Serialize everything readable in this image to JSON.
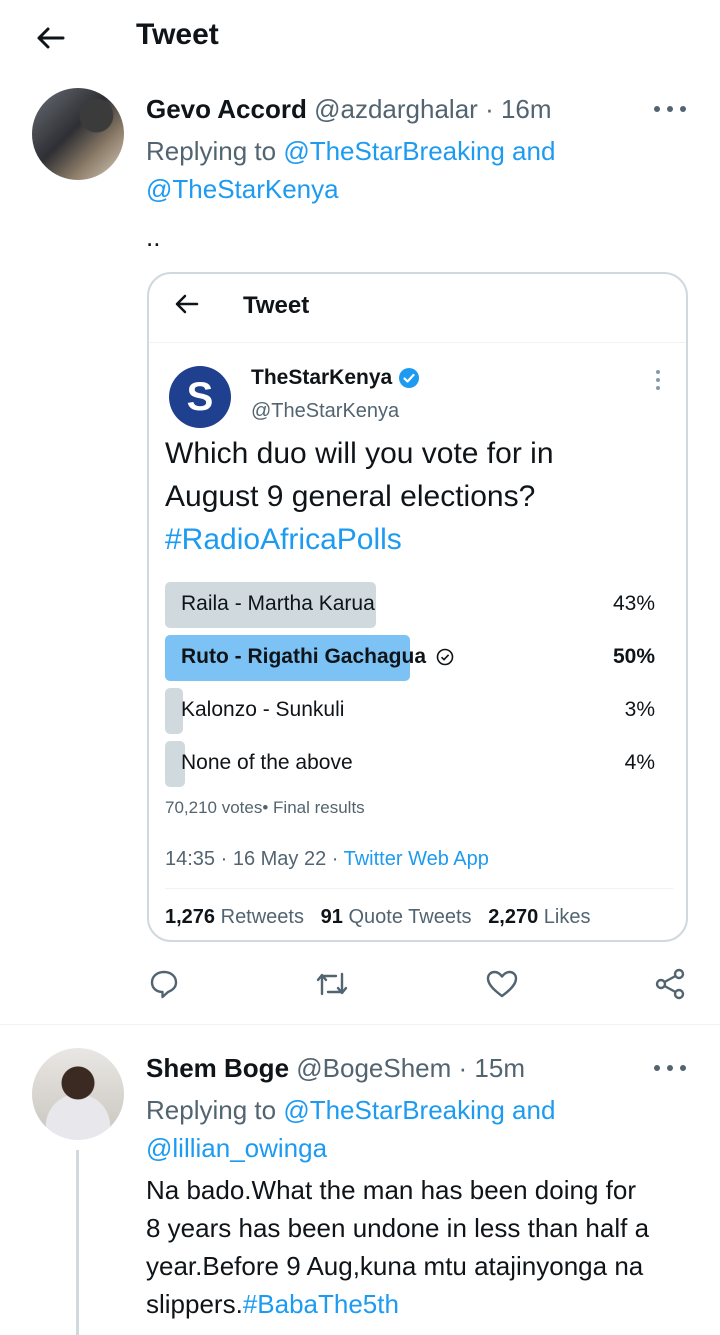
{
  "header": {
    "title": "Tweet"
  },
  "tweet1": {
    "name": "Gevo Accord",
    "handle": "@azdarghalar",
    "time": "· 16m",
    "replying_prefix": "Replying to ",
    "replying_to_1": "@TheStarBreaking and",
    "replying_to_2": "@TheStarKenya",
    "text": "..",
    "embedded": {
      "header_title": "Tweet",
      "logo_letter": "S",
      "name": "TheStarKenya",
      "handle": "@TheStarKenya",
      "text_line1": "Which duo will you vote for in",
      "text_line2": "August 9 general elections?",
      "hashtag": "#RadioAfricaPolls",
      "poll": [
        {
          "label": "Raila - Martha Karua",
          "pct": "43%",
          "value": 43
        },
        {
          "label": "Ruto - Rigathi Gachagua",
          "pct": "50%",
          "value": 50,
          "winner": true
        },
        {
          "label": "Kalonzo - Sunkuli",
          "pct": "3%",
          "value": 3
        },
        {
          "label": "None of the above",
          "pct": "4%",
          "value": 4
        }
      ],
      "votes": "70,210 votes• Final results",
      "time": "14:35 · 16 May 22 · ",
      "source": "Twitter Web App",
      "retweets": "1,276",
      "retweets_label": " Retweets",
      "quotes": "91",
      "quotes_label": " Quote Tweets",
      "likes": "2,270",
      "likes_label": " Likes"
    }
  },
  "tweet2": {
    "name": "Shem Boge",
    "handle": "@BogeShem",
    "time": "· 15m",
    "replying_prefix": "Replying to ",
    "replying_to_1": "@TheStarBreaking and",
    "replying_to_2": "@lillian_owinga",
    "text_line1": "Na bado.What the man has been doing for",
    "text_line2": "8 years has been undone in less than half a",
    "text_line3": "year.Before 9 Aug,kuna mtu atajinyonga na",
    "text_line4": "slippers.",
    "hashtag": "#BabaThe5th"
  },
  "icons": {
    "back": "arrow-left-icon",
    "more": "more-horizontal-icon",
    "verified": "verified-badge-icon",
    "reply": "reply-icon",
    "retweet": "retweet-icon",
    "like": "heart-icon",
    "share": "share-icon"
  },
  "colors": {
    "accent": "#1d9bf0",
    "winner_bar": "#7cc2f4",
    "bar": "#cfd9de",
    "text": "#0f1419",
    "muted": "#536471"
  }
}
